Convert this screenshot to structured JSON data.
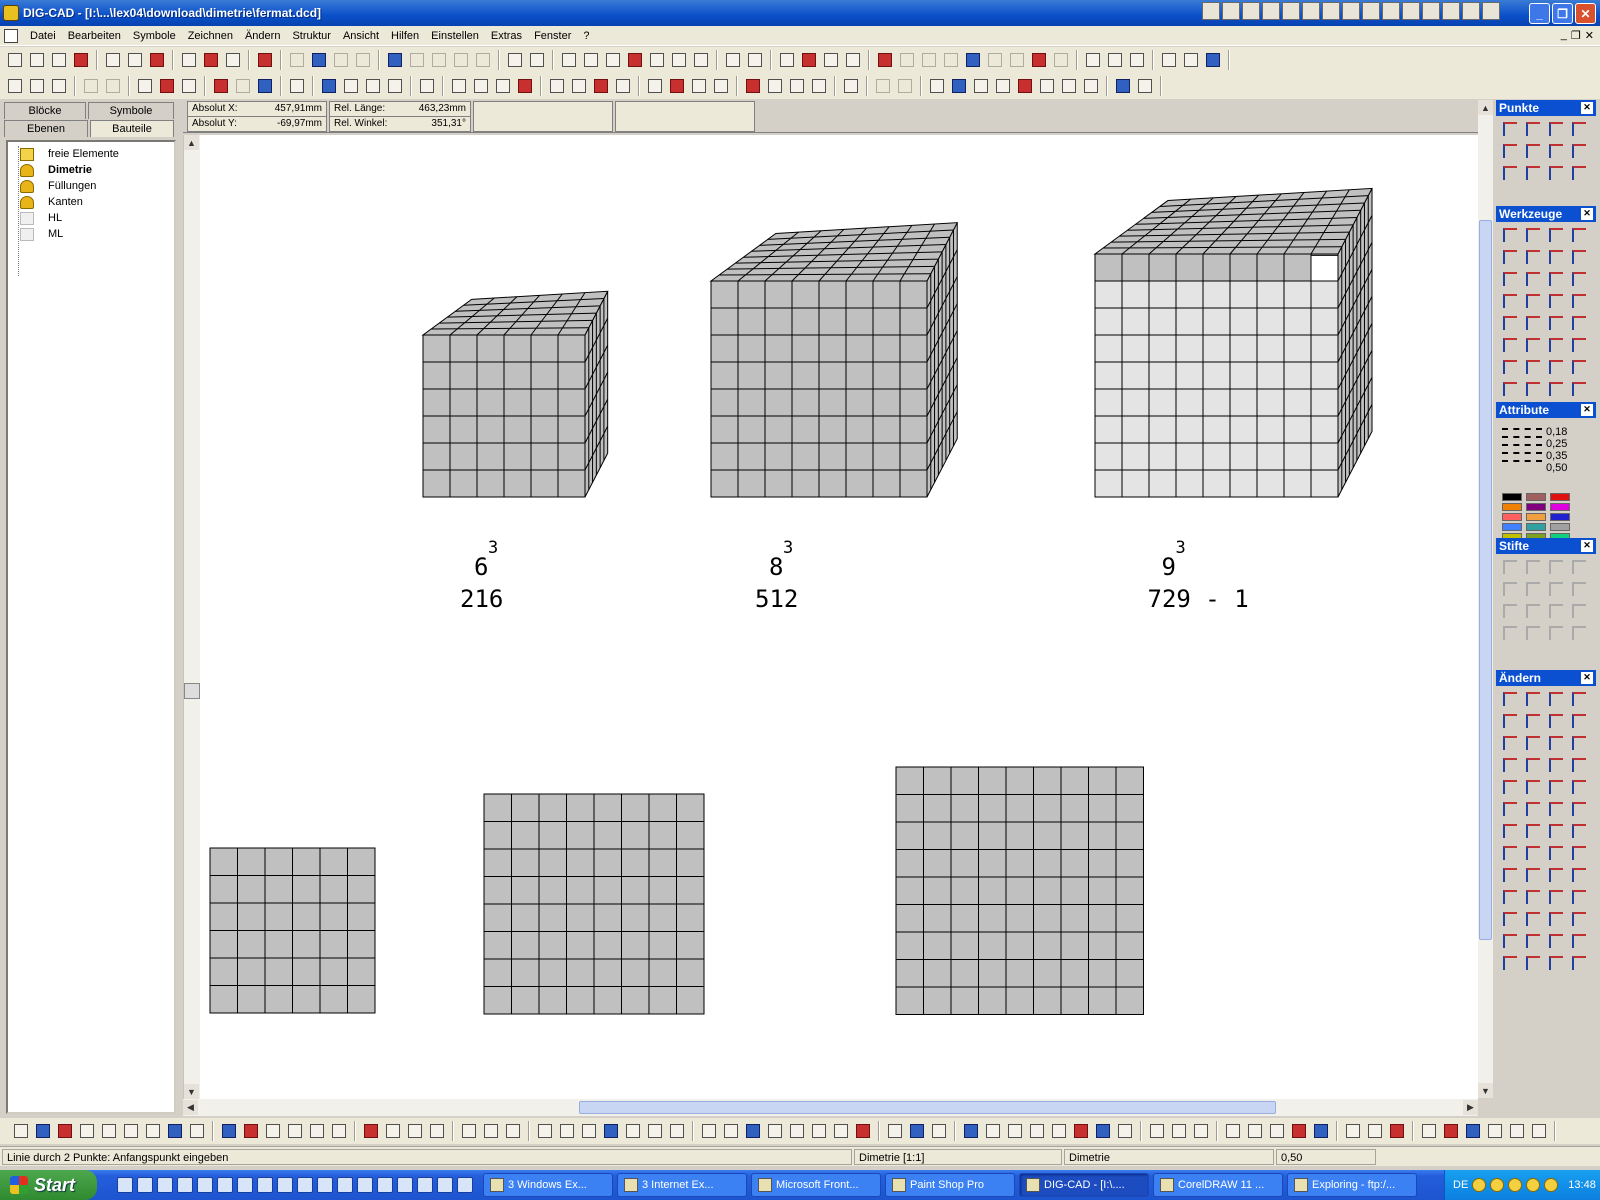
{
  "window": {
    "title": "DIG-CAD - [I:\\...\\lex04\\download\\dimetrie\\fermat.dcd]"
  },
  "menu": {
    "items": [
      "Datei",
      "Bearbeiten",
      "Symbole",
      "Zeichnen",
      "Ändern",
      "Struktur",
      "Ansicht",
      "Hilfen",
      "Einstellen",
      "Extras",
      "Fenster",
      "?"
    ]
  },
  "left_panel": {
    "tabs": [
      "Blöcke",
      "Symbole",
      "Ebenen",
      "Bauteile"
    ],
    "tree": [
      {
        "label": "freie Elemente",
        "bold": false
      },
      {
        "label": "Dimetrie",
        "bold": true
      },
      {
        "label": "Füllungen",
        "bold": false
      },
      {
        "label": "Kanten",
        "bold": false
      },
      {
        "label": "HL",
        "bold": false
      },
      {
        "label": "ML",
        "bold": false
      }
    ]
  },
  "coords": {
    "abs_x_label": "Absolut X:",
    "abs_x_value": "457,91mm",
    "abs_y_label": "Absolut Y:",
    "abs_y_value": "-69,97mm",
    "rel_len_label": "Rel. Länge:",
    "rel_len_value": "463,23mm",
    "rel_ang_label": "Rel. Winkel:",
    "rel_ang_value": "351,31°"
  },
  "drawing": {
    "cubes": [
      {
        "n": 6,
        "exp": "3",
        "base": "6",
        "value": "216",
        "missing": 0
      },
      {
        "n": 8,
        "exp": "3",
        "base": "8",
        "value": "512",
        "missing": 0
      },
      {
        "n": 9,
        "exp": "3",
        "base": "9",
        "value": "729 - 1",
        "missing": 1
      }
    ],
    "squares": [
      {
        "cols": 6,
        "rows": 6
      },
      {
        "cols": 8,
        "rows": 8
      },
      {
        "cols": 9,
        "rows": 9
      }
    ],
    "colors": {
      "face": "#c0c0c0",
      "light": "#e4e4e4",
      "line": "#000000"
    }
  },
  "right_panel": {
    "palettes": [
      "Punkte",
      "Werkzeuge",
      "Attribute",
      "Stifte",
      "Ändern"
    ],
    "line_widths": [
      "0,18",
      "0,25",
      "0,35",
      "0,50"
    ]
  },
  "status": {
    "hint": "Linie durch 2 Punkte: Anfangspunkt eingeben",
    "view": "Dimetrie [1:1]",
    "layer": "Dimetrie",
    "pen": "0,50"
  },
  "taskbar": {
    "start": "Start",
    "tasks": [
      {
        "label": "3 Windows Ex...",
        "active": false
      },
      {
        "label": "3 Internet Ex...",
        "active": false
      },
      {
        "label": "Microsoft Front...",
        "active": false
      },
      {
        "label": "Paint Shop Pro",
        "active": false
      },
      {
        "label": "DIG-CAD - [I:\\....",
        "active": true
      },
      {
        "label": "CorelDRAW 11 ...",
        "active": false
      },
      {
        "label": "Exploring - ftp:/...",
        "active": false
      }
    ],
    "lang": "DE",
    "clock": "13:48"
  }
}
